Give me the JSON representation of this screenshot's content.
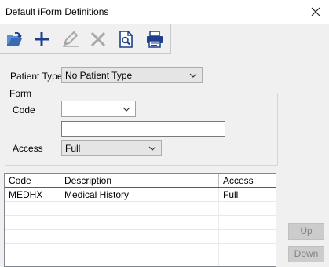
{
  "window": {
    "title": "Default iForm Definitions"
  },
  "toolbar": {
    "buttons": [
      {
        "icon": "open-folder-icon",
        "enabled": true
      },
      {
        "icon": "plus-icon",
        "enabled": true
      },
      {
        "icon": "edit-pencil-icon",
        "enabled": false
      },
      {
        "icon": "delete-x-icon",
        "enabled": false
      },
      {
        "icon": "preview-document-icon",
        "enabled": true
      },
      {
        "icon": "printer-icon",
        "enabled": true
      }
    ]
  },
  "patient_type": {
    "label": "Patient Type",
    "value": "No Patient Type"
  },
  "form_group": {
    "title": "Form",
    "code_label": "Code",
    "code_value": "",
    "description_value": "",
    "access_label": "Access",
    "access_value": "Full"
  },
  "grid": {
    "columns": [
      "Code",
      "Description",
      "Access"
    ],
    "rows": [
      [
        "MEDHX",
        "Medical History",
        "Full"
      ]
    ]
  },
  "side_buttons": {
    "up_label": "Up",
    "down_label": "Down"
  },
  "colors": {
    "accent": "#1f3f8c",
    "disabled": "#a8a8a8"
  }
}
